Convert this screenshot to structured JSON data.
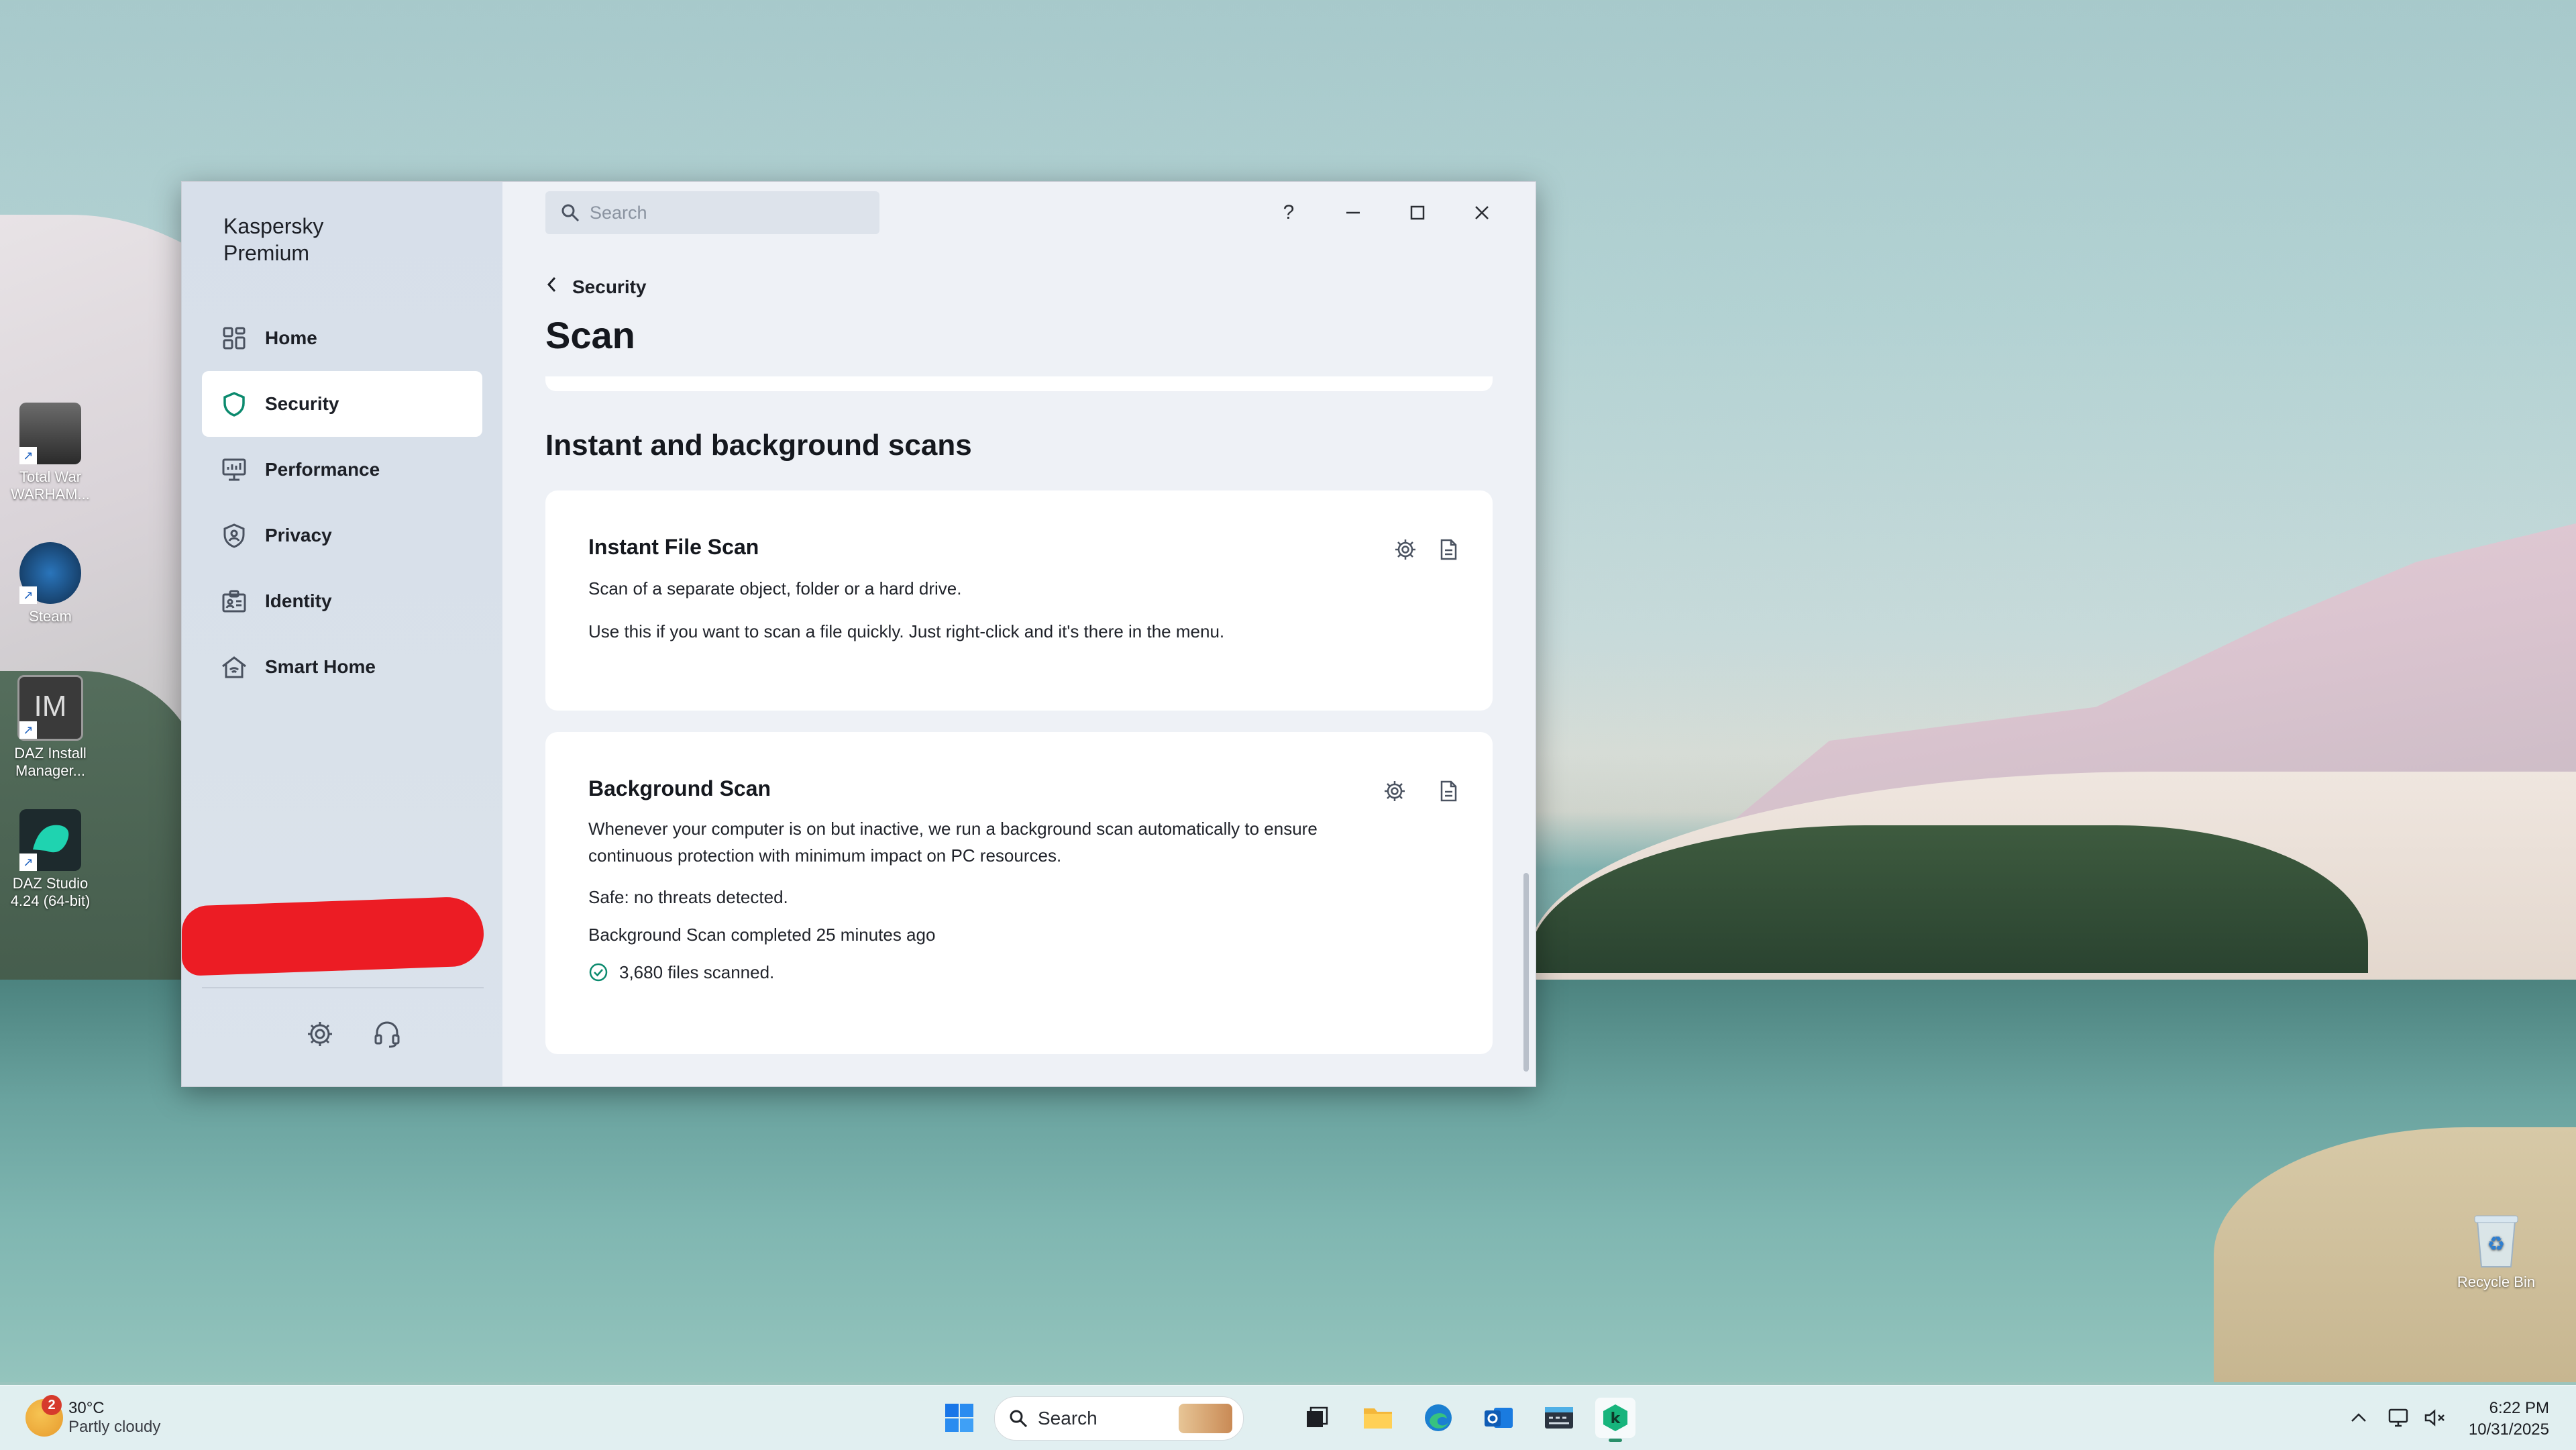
{
  "desktop": {
    "icons": [
      {
        "name": "total-war-icon",
        "label": "Total War WARHAM..."
      },
      {
        "name": "steam-icon",
        "label": "Steam"
      },
      {
        "name": "daz-install-manager-icon",
        "label": "DAZ Install Manager..."
      },
      {
        "name": "daz-studio-icon",
        "label": "DAZ Studio 4.24 (64-bit)"
      },
      {
        "name": "recycle-bin-icon",
        "label": "Recycle Bin"
      }
    ]
  },
  "app": {
    "brand": "Kaspersky Premium",
    "search_placeholder": "Search",
    "window_controls": {
      "help": "?",
      "minimize": "–",
      "maximize": "□",
      "close": "✕"
    },
    "nav": [
      {
        "label": "Home",
        "icon": "home-grid-icon"
      },
      {
        "label": "Security",
        "icon": "shield-icon",
        "active": true
      },
      {
        "label": "Performance",
        "icon": "monitor-icon"
      },
      {
        "label": "Privacy",
        "icon": "privacy-shield-icon"
      },
      {
        "label": "Identity",
        "icon": "id-card-icon"
      },
      {
        "label": "Smart Home",
        "icon": "smart-home-icon"
      }
    ],
    "breadcrumb": "Security",
    "page_title": "Scan",
    "section_title": "Instant and background scans",
    "cards": {
      "instant": {
        "title": "Instant File Scan",
        "line1": "Scan of a separate object, folder or a hard drive.",
        "line2": "Use this if you want to scan a file quickly. Just right-click and it's there in the menu."
      },
      "background": {
        "title": "Background Scan",
        "desc": "Whenever your computer is on but inactive, we run a background scan automatically to ensure continuous protection with minimum impact on PC resources.",
        "status": "Safe: no threats detected.",
        "completed": "Background Scan completed 25 minutes ago",
        "files": "3,680 files scanned."
      }
    },
    "accent_color": "#0b8a6e"
  },
  "taskbar": {
    "weather": {
      "badge": "2",
      "temp": "30°C",
      "condition": "Partly cloudy"
    },
    "search_placeholder": "Search",
    "clock": {
      "time": "6:22 PM",
      "date": "10/31/2025"
    }
  }
}
